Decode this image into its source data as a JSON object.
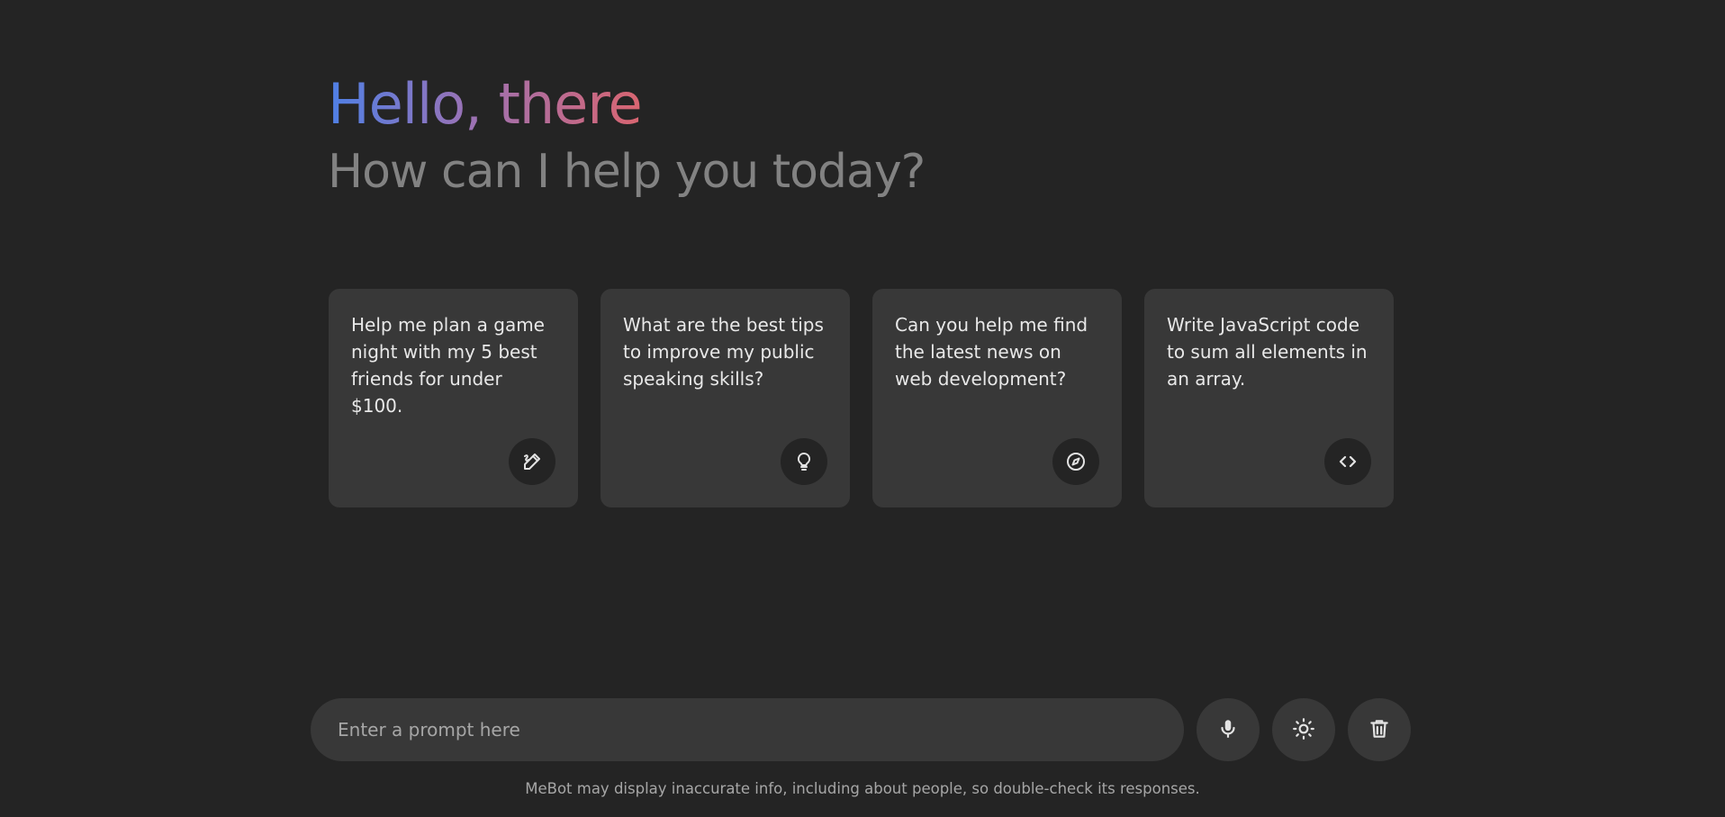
{
  "header": {
    "greeting": "Hello, there",
    "subtitle": "How can I help you today?"
  },
  "suggestions": [
    {
      "text": "Help me plan a game night with my 5 best friends for under $100.",
      "icon": "draw-icon"
    },
    {
      "text": "What are the best tips to improve my public speaking skills?",
      "icon": "lightbulb-icon"
    },
    {
      "text": "Can you help me find the latest news on web development?",
      "icon": "explore-icon"
    },
    {
      "text": "Write JavaScript code to sum all elements in an array.",
      "icon": "code-icon"
    }
  ],
  "prompt": {
    "placeholder": "Enter a prompt here",
    "value": ""
  },
  "actions": {
    "mic_icon": "mic-icon",
    "theme_icon": "light-mode-icon",
    "delete_icon": "delete-icon"
  },
  "disclaimer": "MeBot may display inaccurate info, including about people, so double-check its responses.",
  "colors": {
    "background": "#242424",
    "surface": "#383838",
    "gradient_start": "#4e80e6",
    "gradient_mid": "#9b72b5",
    "gradient_end": "#d96570",
    "subtitle": "#828282"
  }
}
